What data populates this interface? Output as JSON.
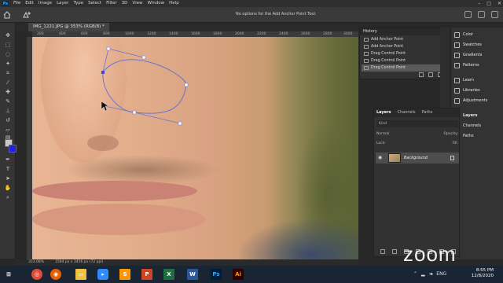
{
  "app": {
    "logo_text": "Ps"
  },
  "menu": [
    "File",
    "Edit",
    "Image",
    "Layer",
    "Type",
    "Select",
    "Filter",
    "3D",
    "View",
    "Window",
    "Help"
  ],
  "window_controls": [
    "–",
    "□",
    "✕"
  ],
  "options_bar": {
    "message": "No options for the Add Anchor Point Tool."
  },
  "document": {
    "tab_title": "IMG_1221.JPG @ 353% (RGB/8) *",
    "ruler_ticks": [
      "200",
      "400",
      "600",
      "800",
      "1000",
      "1200",
      "1400",
      "1600",
      "1800",
      "2000",
      "2200",
      "2400",
      "2600",
      "2800",
      "3000"
    ]
  },
  "status": {
    "zoom": "353.08%",
    "size": "1584 px x 3456 px (72 ppi)"
  },
  "history": {
    "title": "History",
    "items": [
      "Add Anchor Point",
      "Add Anchor Point",
      "Drag Control Point",
      "Drag Control Point",
      "Drag Control Point"
    ],
    "selected_index": 4
  },
  "right_panels": [
    "Color",
    "Swatches",
    "Gradients",
    "Patterns",
    "Learn",
    "Libraries",
    "Adjustments",
    "Layers",
    "Channels",
    "Paths"
  ],
  "layers": {
    "tabs": [
      "Layers",
      "Channels",
      "Paths"
    ],
    "kind_label": "Kind",
    "mode": "Normal",
    "opacity_label": "Opacity:",
    "lock_label": "Lock:",
    "fill_label": "Fill:",
    "layer_name": "Background"
  },
  "zoom_watermark": "zoom",
  "taskbar": {
    "apps": [
      "Chrome",
      "Firefox",
      "Explorer",
      "Zoom",
      "Sublime",
      "PowerPoint",
      "Excel",
      "Word",
      "Photoshop",
      "Illustrator"
    ],
    "time": "8:55 PM",
    "date": "12/8/2020",
    "lang": "ENG"
  },
  "colors": {
    "foreground": "#c8c8c8",
    "background": "#1b1ff0",
    "path": "#4a5bd6"
  }
}
